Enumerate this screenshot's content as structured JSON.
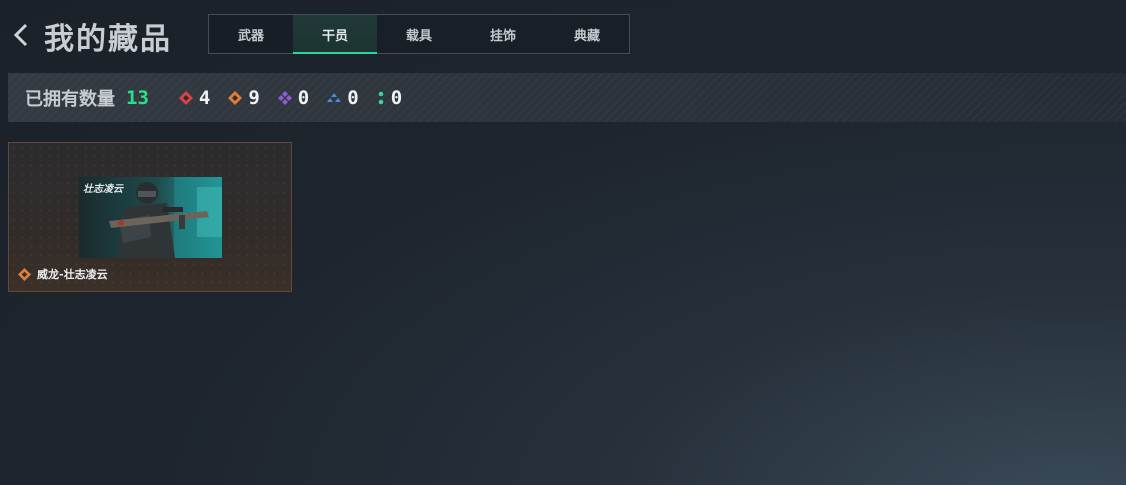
{
  "header": {
    "title": "我的藏品",
    "tabs": [
      {
        "label": "武器",
        "active": false
      },
      {
        "label": "干员",
        "active": true
      },
      {
        "label": "载具",
        "active": false
      },
      {
        "label": "挂饰",
        "active": false
      },
      {
        "label": "典藏",
        "active": false
      }
    ]
  },
  "stats": {
    "label": "已拥有数量",
    "total": "13",
    "rarities": [
      {
        "icon": "red-diamond-icon",
        "color": "#d64545",
        "count": "4"
      },
      {
        "icon": "orange-diamond-icon",
        "color": "#d9803e",
        "count": "9"
      },
      {
        "icon": "purple-diamond-cluster-icon",
        "color": "#8f5cd8",
        "count": "0"
      },
      {
        "icon": "blue-triangle-cluster-icon",
        "color": "#4a8ad8",
        "count": "0"
      },
      {
        "icon": "green-dots-icon",
        "color": "#2fd79a",
        "count": "0"
      }
    ]
  },
  "items": [
    {
      "name": "威龙-壮志凌云",
      "image_text": "壮志凌云",
      "rarity_color": "#d9803e"
    }
  ],
  "colors": {
    "accent": "#2fd79a",
    "total": "#27e08a"
  }
}
